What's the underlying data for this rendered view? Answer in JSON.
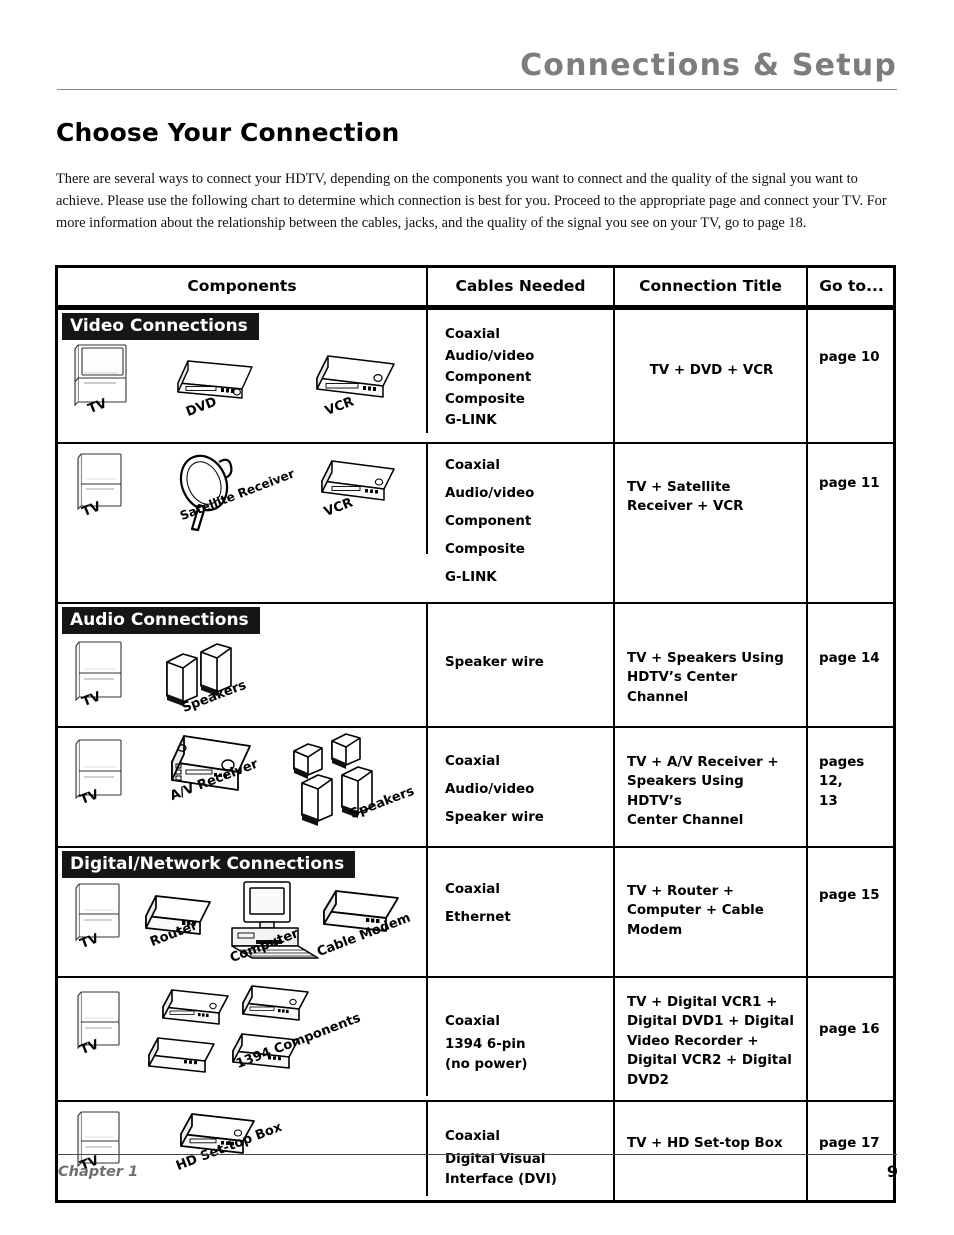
{
  "header": {
    "title": "Connections & Setup"
  },
  "page_title": "Choose Your Connection",
  "intro": "There are several ways to connect your HDTV, depending on the components you want to connect and the quality of the signal you want to achieve. Please use the following chart to determine which connection is best for you. Proceed to the appropriate page and connect your TV. For more information about the relationship between the cables, jacks, and the quality of the signal you see on your TV, go to page 18.",
  "table": {
    "columns": [
      "Components",
      "Cables Needed",
      "Connection Title",
      "Go to..."
    ],
    "sections": [
      {
        "banner": "Video Connections"
      },
      {
        "banner": "Audio Connections"
      },
      {
        "banner": "Digital/Network Connections"
      }
    ],
    "rows": [
      {
        "banner": "Video Connections",
        "devices": [
          "TV",
          "DVD",
          "VCR"
        ],
        "device_icons": [
          "tv-icon",
          "dvd-player-icon",
          "vcr-icon"
        ],
        "cables": "Coaxial\nAudio/video\nComponent\nComposite\nG-LINK",
        "connection_title": "TV +  DVD + VCR",
        "go_to": "page 10"
      },
      {
        "devices": [
          "TV",
          "Satellite Receiver",
          "VCR"
        ],
        "device_icons": [
          "tv-icon",
          "satellite-dish-icon",
          "vcr-icon"
        ],
        "cables": "Coaxial\nAudio/video\nComponent\nComposite\nG-LINK",
        "connection_title": "TV + Satellite\nReceiver + VCR",
        "go_to": "page 11"
      },
      {
        "banner": "Audio Connections",
        "devices": [
          "TV",
          "Speakers"
        ],
        "device_icons": [
          "tv-icon",
          "speakers-icon"
        ],
        "cables": "Speaker wire",
        "connection_title": "TV +  Speakers Using\nHDTV’s Center Channel",
        "go_to": "page 14"
      },
      {
        "devices": [
          "TV",
          "A/V Receiver",
          "Speakers"
        ],
        "device_icons": [
          "tv-icon",
          "av-receiver-icon",
          "speakers-icon"
        ],
        "cables": "Coaxial\nAudio/video\nSpeaker wire",
        "connection_title": "TV + A/V Receiver +\nSpeakers Using HDTV’s\nCenter Channel",
        "go_to": "pages 12,\n13"
      },
      {
        "banner": "Digital/Network Connections",
        "devices": [
          "TV",
          "Router",
          "Computer",
          "Cable Modem"
        ],
        "device_icons": [
          "tv-icon",
          "router-icon",
          "computer-icon",
          "cable-modem-icon"
        ],
        "cables": "Coaxial\nEthernet",
        "connection_title": "TV + Router +\nComputer + Cable\nModem",
        "go_to": "page 15"
      },
      {
        "devices": [
          "TV",
          "1394 Components"
        ],
        "device_icons": [
          "tv-icon",
          "1394-components-icon"
        ],
        "cables": "Coaxial\n1394 6-pin\n(no power)",
        "connection_title": "TV + Digital VCR1 +\nDigital DVD1 + Digital\nVideo Recorder +\nDigital VCR2 + Digital\nDVD2",
        "go_to": "page 16"
      },
      {
        "devices": [
          "TV",
          "HD Set-top Box"
        ],
        "device_icons": [
          "tv-icon",
          "hd-settop-box-icon"
        ],
        "cables": "Coaxial\nDigital Visual\nInterface (DVI)",
        "connection_title": "TV + HD Set-top Box",
        "go_to": "page 17"
      }
    ]
  },
  "labels": {
    "tv": "TV",
    "dvd": "DVD",
    "vcr": "VCR",
    "satellite_receiver": "Satellite Receiver",
    "speakers": "Speakers",
    "av_receiver": "A/V Receiver",
    "router": "Router",
    "computer": "Computer",
    "cable_modem": "Cable Modem",
    "components_1394": "1394 Components",
    "hd_settop_box": "HD Set-top Box"
  },
  "cables_rows": {
    "r1": [
      "Coaxial",
      "Audio/video",
      "Component",
      "Composite",
      "G-LINK"
    ],
    "r2": [
      "Coaxial",
      "Audio/video",
      "Component",
      "Composite",
      "G-LINK"
    ],
    "r3": [
      "Speaker wire"
    ],
    "r4": [
      "Coaxial",
      "Audio/video",
      "Speaker wire"
    ],
    "r5": [
      "Coaxial",
      "Ethernet"
    ],
    "r6": [
      "Coaxial",
      "1394 6-pin",
      "(no power)"
    ],
    "r7": [
      "Coaxial",
      "Digital Visual",
      "Interface (DVI)"
    ]
  },
  "titles_rows": {
    "r1": [
      "TV +  DVD + VCR"
    ],
    "r2": [
      "TV + Satellite",
      "Receiver + VCR"
    ],
    "r3": [
      "TV +  Speakers Using",
      "HDTV’s Center Channel"
    ],
    "r4": [
      "TV + A/V Receiver +",
      "Speakers Using HDTV’s",
      "Center Channel"
    ],
    "r5": [
      "TV + Router +",
      "Computer + Cable",
      "Modem"
    ],
    "r6": [
      "TV + Digital VCR1 +",
      "Digital DVD1 + Digital",
      "Video Recorder +",
      "Digital VCR2 + Digital",
      "DVD2"
    ],
    "r7": [
      "TV + HD Set-top Box"
    ]
  },
  "goto_rows": {
    "r1": "page 10",
    "r2": "page 11",
    "r3": "page 14",
    "r4a": "pages 12,",
    "r4b": "13",
    "r5": "page 15",
    "r6": "page 16",
    "r7": "page 17"
  },
  "footer": {
    "chapter": "Chapter 1",
    "page_number": "9"
  },
  "colors": {
    "header_gray": "#7d7d7d",
    "banner_bg": "#161616",
    "rule": "#8a8a8a",
    "text": "#000000"
  }
}
